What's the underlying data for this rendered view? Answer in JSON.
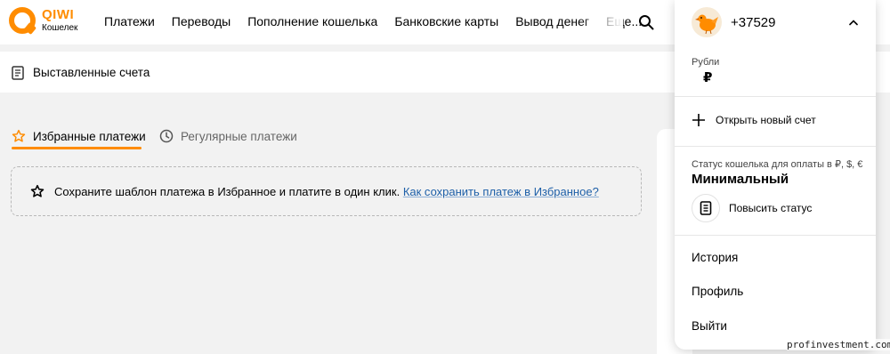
{
  "brand": {
    "name": "QIWI",
    "subtitle": "Кошелек"
  },
  "nav": {
    "items": [
      "Платежи",
      "Переводы",
      "Пополнение кошелька",
      "Банковские карты",
      "Вывод денег",
      "Еще..."
    ]
  },
  "subbar": {
    "invoices_label": "Выставленные счета"
  },
  "tabs": {
    "favorites": "Избранные платежи",
    "regular": "Регулярные платежи"
  },
  "hint": {
    "text": "Сохраните шаблон платежа в Избранное и платите в один клик.",
    "link": "Как сохранить платеж в Избранное?"
  },
  "account_menu": {
    "phone": "+37529",
    "balance_label": "Рубли",
    "balance_value": "₽",
    "open_account": "Открыть новый счет",
    "status_label": "Статус кошелька для оплаты в ₽, $, €",
    "status_value": "Минимальный",
    "raise_status": "Повысить статус",
    "items": [
      "История",
      "Профиль",
      "Выйти"
    ]
  },
  "watermark": "profinvestment.com",
  "colors": {
    "accent": "#ff8c00",
    "link": "#1d5fa8",
    "background": "#f2f2f2"
  }
}
